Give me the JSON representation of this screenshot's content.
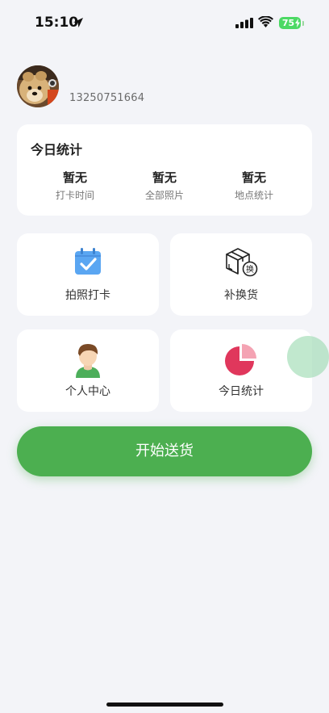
{
  "status_bar": {
    "time": "15:10",
    "battery": "75"
  },
  "profile": {
    "phone": "13250751664"
  },
  "stats": {
    "title": "今日统计",
    "items": [
      {
        "value": "暂无",
        "label": "打卡时间"
      },
      {
        "value": "暂无",
        "label": "全部照片"
      },
      {
        "value": "暂无",
        "label": "地点统计"
      }
    ]
  },
  "menu": [
    {
      "label": "拍照打卡",
      "icon": "calendar-check-icon"
    },
    {
      "label": "补换货",
      "icon": "box-exchange-icon"
    },
    {
      "label": "个人中心",
      "icon": "person-icon"
    },
    {
      "label": "今日统计",
      "icon": "pie-chart-icon"
    }
  ],
  "start_button": {
    "label": "开始送货"
  },
  "colors": {
    "accent": "#4caf50",
    "calendar": "#5aa6f2",
    "pie": "#e0375c",
    "pie_slice": "#f4a3b3"
  }
}
